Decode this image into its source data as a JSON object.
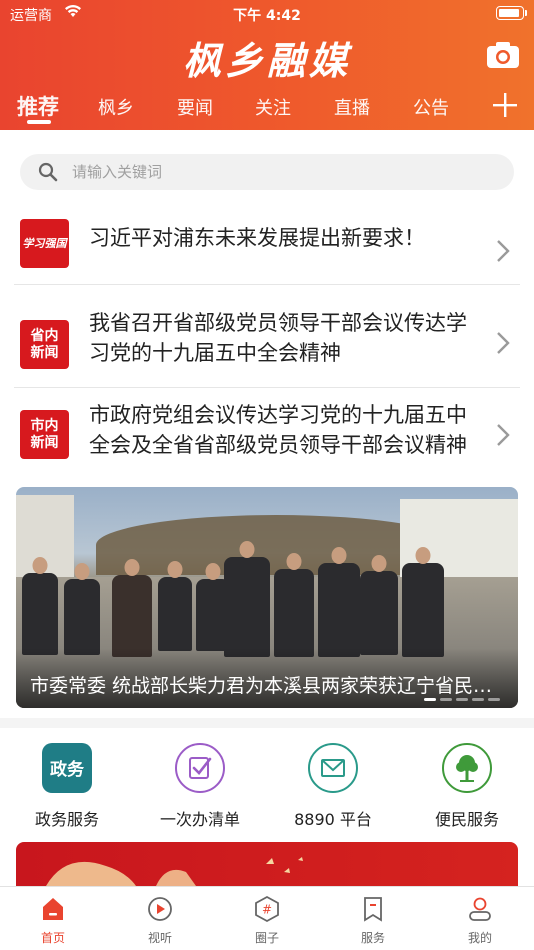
{
  "status_bar": {
    "carrier": "运营商",
    "time": "下午 4:42",
    "battery_level": 0.9
  },
  "header": {
    "title": "枫乡融媒"
  },
  "tabs": [
    {
      "label": "推荐",
      "active": true
    },
    {
      "label": "枫乡"
    },
    {
      "label": "要闻"
    },
    {
      "label": "关注"
    },
    {
      "label": "直播"
    },
    {
      "label": "公告"
    }
  ],
  "search": {
    "placeholder": "请输入关键词"
  },
  "news": [
    {
      "badge": "学习强国",
      "badge_icon": "xuexi-qiangguo-logo",
      "title": "习近平对浦东未来发展提出新要求！"
    },
    {
      "badge": "省内新闻",
      "title": "我省召开省部级党员领导干部会议传达学习党的十九届五中全会精神"
    },
    {
      "badge": "市内新闻",
      "title": "市政府党组会议传达学习党的十九届五中全会及全省省部级党员领导干部会议精神"
    }
  ],
  "banner": {
    "caption": "市委常委 统战部长柴力君为本溪县两家荣获辽宁省民族团结进步模范集体授牌"
  },
  "services": [
    {
      "label": "政务服务",
      "icon": "government-affairs-icon",
      "icon_text": "政务",
      "color": "#1f7d86"
    },
    {
      "label": "一次办清单",
      "icon": "checklist-icon",
      "color": "#9b5cc7"
    },
    {
      "label": "8890 平台",
      "icon": "mail-icon",
      "color": "#2a9a8a"
    },
    {
      "label": "便民服务",
      "icon": "tree-icon",
      "color": "#3f9a3a"
    }
  ],
  "tabbar": [
    {
      "label": "首页",
      "icon": "home-icon",
      "active": true
    },
    {
      "label": "视听",
      "icon": "play-icon"
    },
    {
      "label": "圈子",
      "icon": "hashtag-icon"
    },
    {
      "label": "服务",
      "icon": "bookmark-icon"
    },
    {
      "label": "我的",
      "icon": "profile-icon"
    }
  ],
  "colors": {
    "accent": "#e9442f",
    "badge_red": "#d7191e"
  }
}
